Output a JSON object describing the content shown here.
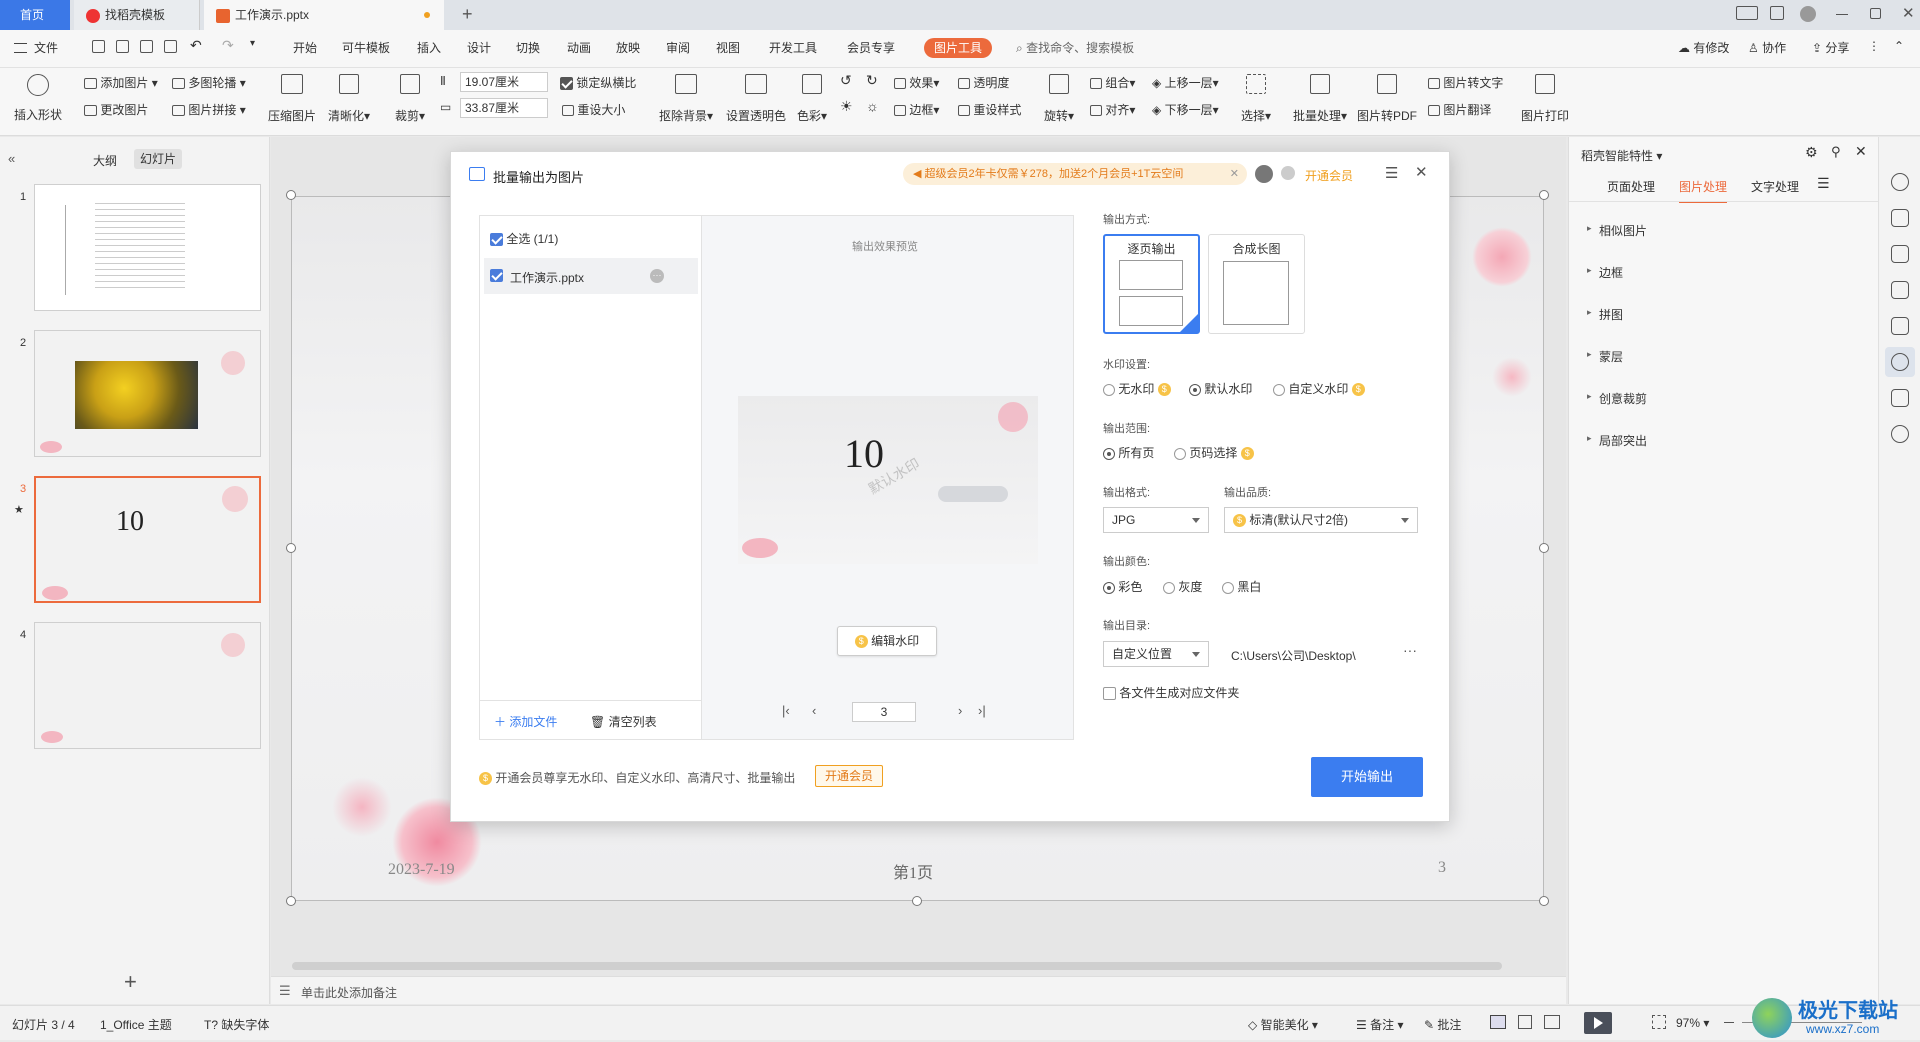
{
  "tabs": {
    "home": "首页",
    "template": "找稻壳模板",
    "doc": "工作演示.pptx"
  },
  "menu": {
    "file": "文件",
    "items": [
      "开始",
      "可牛模板",
      "插入",
      "设计",
      "切换",
      "动画",
      "放映",
      "审阅",
      "视图",
      "开发工具",
      "会员专享"
    ],
    "active": "图片工具",
    "search": "查找命令、搜索模板",
    "right": [
      "有修改",
      "协作",
      "分享"
    ]
  },
  "ribbon": {
    "insert_shape": "插入形状",
    "add_image": "添加图片",
    "multi_carousel": "多图轮播",
    "change_image": "更改图片",
    "image_splice": "图片拼接",
    "compress": "压缩图片",
    "sharpen": "清晰化",
    "crop": "裁剪",
    "height": "19.07厘米",
    "width": "33.87厘米",
    "lock_ratio": "锁定纵横比",
    "reset_size": "重设大小",
    "remove_bg": "抠除背景",
    "set_transparent": "设置透明色",
    "color": "色彩",
    "effect": "效果",
    "border": "边框",
    "transparency": "透明度",
    "reset_style": "重设样式",
    "rotate": "旋转",
    "group": "组合",
    "align": "对齐",
    "bring_up": "上移一层",
    "send_down": "下移一层",
    "select": "选择",
    "batch": "批量处理",
    "to_pdf": "图片转PDF",
    "to_text": "图片转文字",
    "translate": "图片翻译",
    "print": "图片打印"
  },
  "leftpanel": {
    "tab_outline": "大纲",
    "tab_slides": "幻灯片",
    "slides": [
      {
        "num": "1"
      },
      {
        "num": "2"
      },
      {
        "num": "3",
        "text": "10"
      },
      {
        "num": "4"
      }
    ]
  },
  "slide": {
    "date": "2023-7-19",
    "page": "第1页",
    "num": "3"
  },
  "notes": "单击此处添加备注",
  "dialog": {
    "title": "批量输出为图片",
    "promo": "超级会员2年卡仅需￥278，加送2个月会员+1T云空间",
    "open_vip": "开通会员",
    "select_all": "全选 (1/1)",
    "file_name": "工作演示.pptx",
    "add_file": "添加文件",
    "clear_list": "清空列表",
    "preview_label": "输出效果预览",
    "preview_number": "10",
    "preview_watermark": "默认水印",
    "edit_watermark": "编辑水印",
    "page_input": "3",
    "output_mode_label": "输出方式:",
    "mode_single": "逐页输出",
    "mode_long": "合成长图",
    "watermark_label": "水印设置:",
    "wm_none": "无水印",
    "wm_default": "默认水印",
    "wm_custom": "自定义水印",
    "range_label": "输出范围:",
    "range_all": "所有页",
    "range_select": "页码选择",
    "format_label": "输出格式:",
    "format_value": "JPG",
    "quality_label": "输出品质:",
    "quality_value": "标清(默认尺寸2倍)",
    "color_label": "输出颜色:",
    "color_full": "彩色",
    "color_gray": "灰度",
    "color_bw": "黑白",
    "dir_label": "输出目录:",
    "dir_select": "自定义位置",
    "dir_path": "C:\\Users\\公司\\Desktop\\",
    "each_folder": "各文件生成对应文件夹",
    "footer_tip": "开通会员尊享无水印、自定义水印、高清尺寸、批量输出",
    "footer_vip": "开通会员",
    "start": "开始输出"
  },
  "rightpanel": {
    "title": "稻壳智能特性",
    "tabs": [
      "页面处理",
      "图片处理",
      "文字处理"
    ],
    "items": [
      "相似图片",
      "边框",
      "拼图",
      "蒙层",
      "创意裁剪",
      "局部突出"
    ]
  },
  "status": {
    "slide": "幻灯片 3 / 4",
    "theme": "1_Office 主题",
    "missing_font": "缺失字体",
    "beautify": "智能美化",
    "notes": "备注",
    "comment": "批注",
    "zoom": "97%"
  },
  "watermark_logo": {
    "text": "极光下载站",
    "url": "www.xz7.com"
  },
  "colors": {
    "accent": "#ec6a3c",
    "blue": "#3b7df0",
    "vip": "#f0a020"
  }
}
